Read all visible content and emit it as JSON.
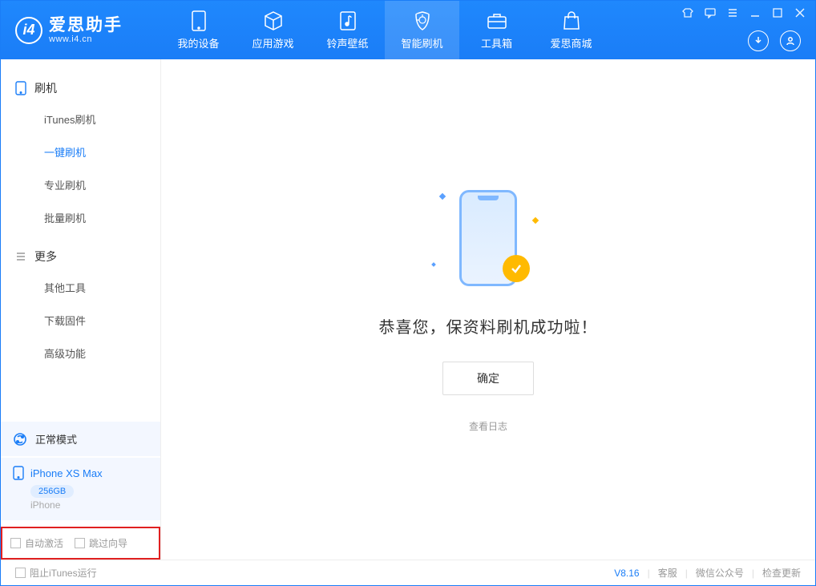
{
  "app": {
    "title": "爱思助手",
    "subtitle": "www.i4.cn"
  },
  "nav": {
    "tabs": [
      {
        "label": "我的设备",
        "icon": "device"
      },
      {
        "label": "应用游戏",
        "icon": "cube"
      },
      {
        "label": "铃声壁纸",
        "icon": "note"
      },
      {
        "label": "智能刷机",
        "icon": "shield",
        "active": true
      },
      {
        "label": "工具箱",
        "icon": "toolbox"
      },
      {
        "label": "爱思商城",
        "icon": "bag"
      }
    ]
  },
  "sidebar": {
    "group1": {
      "title": "刷机",
      "items": [
        "iTunes刷机",
        "一键刷机",
        "专业刷机",
        "批量刷机"
      ],
      "activeIndex": 1
    },
    "group2": {
      "title": "更多",
      "items": [
        "其他工具",
        "下载固件",
        "高级功能"
      ]
    },
    "mode": {
      "label": "正常模式"
    },
    "device": {
      "name": "iPhone XS Max",
      "capacity": "256GB",
      "type": "iPhone"
    },
    "options": {
      "auto_activate": "自动激活",
      "skip_guide": "跳过向导"
    }
  },
  "main": {
    "success_msg": "恭喜您，保资料刷机成功啦！",
    "ok": "确定",
    "view_log": "查看日志"
  },
  "status": {
    "block_itunes": "阻止iTunes运行",
    "version": "V8.16",
    "links": [
      "客服",
      "微信公众号",
      "检查更新"
    ]
  }
}
